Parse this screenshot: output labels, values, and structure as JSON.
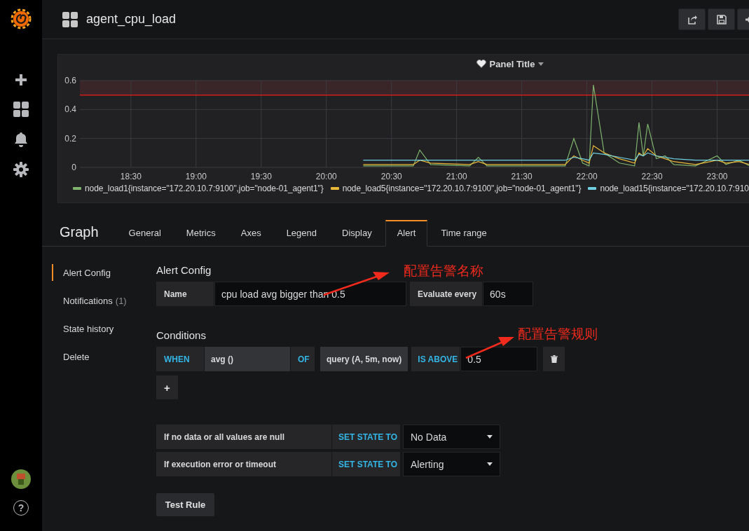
{
  "sidebar": {
    "help": "?"
  },
  "dashboard": {
    "title": "agent_cpu_load"
  },
  "panel": {
    "title": "Panel Title",
    "chart_data": {
      "type": "line",
      "x": [
        20.283,
        20.667,
        20.717,
        20.8,
        21.1,
        21.167,
        21.233,
        21.833,
        21.9,
        21.967,
        22.017,
        22.05,
        22.133,
        22.25,
        22.367,
        22.4,
        22.433,
        22.467,
        22.533,
        22.6,
        22.667,
        22.833,
        23.0,
        23.067,
        23.167,
        23.25
      ],
      "series": [
        {
          "name": "node_load1{instance=\"172.20.10.7:9100\",job=\"node-01_agent1\"}",
          "color": "#7eb26d",
          "values": [
            0.01,
            0.01,
            0.12,
            0.02,
            0.01,
            0.07,
            0.01,
            0.01,
            0.2,
            0.03,
            0.01,
            0.57,
            0.1,
            0.03,
            0.01,
            0.31,
            0.08,
            0.3,
            0.06,
            0.08,
            0.02,
            0.01,
            0.08,
            0.02,
            0.05,
            0.01
          ]
        },
        {
          "name": "node_load5{instance=\"172.20.10.7:9100\",job=\"node-01_agent1\"}",
          "color": "#eab839",
          "values": [
            0.02,
            0.02,
            0.05,
            0.03,
            0.02,
            0.04,
            0.02,
            0.02,
            0.08,
            0.05,
            0.03,
            0.15,
            0.1,
            0.06,
            0.03,
            0.1,
            0.08,
            0.13,
            0.08,
            0.06,
            0.04,
            0.02,
            0.05,
            0.03,
            0.04,
            0.02
          ]
        },
        {
          "name": "node_load15{instance=\"172.20.10.7:910",
          "color": "#6ed0e0",
          "values": [
            0.05,
            0.05,
            0.05,
            0.05,
            0.05,
            0.05,
            0.05,
            0.05,
            0.07,
            0.06,
            0.05,
            0.1,
            0.09,
            0.07,
            0.05,
            0.09,
            0.08,
            0.1,
            0.08,
            0.07,
            0.06,
            0.05,
            0.05,
            0.05,
            0.05,
            0.05
          ]
        }
      ],
      "xlim": [
        18.108,
        23.25
      ],
      "ylim": [
        0,
        0.6
      ],
      "grid": true,
      "xticks": [
        {
          "value": 18.5,
          "label": "18:30"
        },
        {
          "value": 19,
          "label": "19:00"
        },
        {
          "value": 19.5,
          "label": "19:30"
        },
        {
          "value": 20,
          "label": "20:00"
        },
        {
          "value": 20.5,
          "label": "20:30"
        },
        {
          "value": 21,
          "label": "21:00"
        },
        {
          "value": 21.5,
          "label": "21:30"
        },
        {
          "value": 22,
          "label": "22:00"
        },
        {
          "value": 22.5,
          "label": "22:30"
        },
        {
          "value": 23,
          "label": "23:00"
        }
      ],
      "yticks": [
        0,
        0.2,
        0.4,
        0.6
      ],
      "ref_lines": [
        {
          "axis": "y",
          "value": 0.5,
          "color": "#d11c1c"
        }
      ],
      "bands": [
        {
          "axis": "y",
          "from": 0.5,
          "to": 0.6,
          "color": "#3a2528"
        }
      ]
    }
  },
  "editor": {
    "title": "Graph",
    "tabs": [
      {
        "label": "General",
        "selected": false
      },
      {
        "label": "Metrics",
        "selected": false
      },
      {
        "label": "Axes",
        "selected": false
      },
      {
        "label": "Legend",
        "selected": false
      },
      {
        "label": "Display",
        "selected": false
      },
      {
        "label": "Alert",
        "selected": true
      },
      {
        "label": "Time range",
        "selected": false
      }
    ]
  },
  "alert_menu": [
    {
      "label": "Alert Config",
      "selected": true
    },
    {
      "label": "Notifications",
      "count": "(1)",
      "selected": false
    },
    {
      "label": "State history",
      "selected": false
    },
    {
      "label": "Delete",
      "selected": false
    }
  ],
  "alert_config": {
    "heading": "Alert Config",
    "name_label": "Name",
    "name_value": "cpu load avg bigger than 0.5",
    "evaluate_label": "Evaluate every",
    "evaluate_value": "60s"
  },
  "conditions": {
    "heading": "Conditions",
    "rows": [
      {
        "when": "WHEN",
        "reducer": "avg ()",
        "of": "OF",
        "query": "query (A, 5m, now)",
        "evaluator": "IS ABOVE",
        "threshold": "0.5"
      }
    ],
    "add_button": "+"
  },
  "state_rules": [
    {
      "label": "If no data or all values are null",
      "action": "SET STATE TO",
      "value": "No Data"
    },
    {
      "label": "If execution error or timeout",
      "action": "SET STATE TO",
      "value": "Alerting"
    }
  ],
  "test_button": "Test Rule",
  "annotations": [
    {
      "text": "配置告警名称"
    },
    {
      "text": "配置告警规则"
    }
  ]
}
